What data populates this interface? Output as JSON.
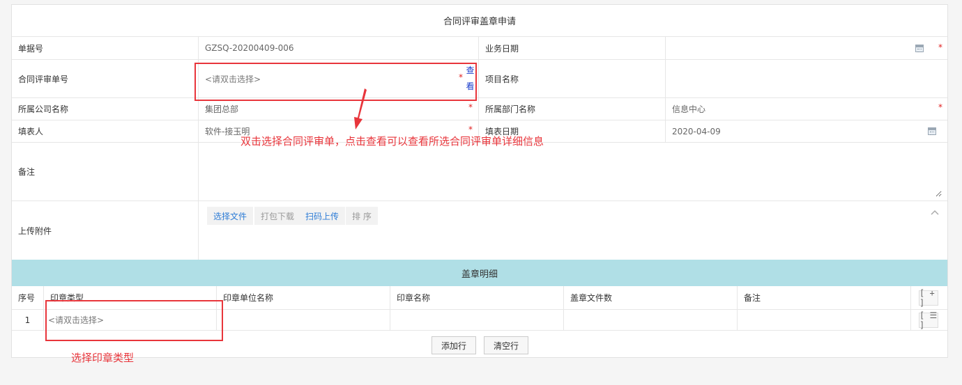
{
  "form": {
    "title": "合同评审盖章申请",
    "required_mark": "*",
    "fields": {
      "doc_no_label": "单据号",
      "doc_no_value": "GZSQ-20200409-006",
      "biz_date_label": "业务日期",
      "biz_date_value": "",
      "review_no_label": "合同评审单号",
      "review_no_placeholder": "<请双击选择>",
      "view_link_1": "查",
      "view_link_2": "看",
      "project_label": "项目名称",
      "project_value": "",
      "company_label": "所属公司名称",
      "company_value": "集团总部",
      "dept_label": "所属部门名称",
      "dept_value": "信息中心",
      "filler_label": "填表人",
      "filler_value": "软件-接玉明",
      "fill_date_label": "填表日期",
      "fill_date_value": "2020-04-09",
      "remark_label": "备注",
      "remark_value": "",
      "attach_label": "上传附件"
    },
    "upload_buttons": [
      "选择文件",
      "打包下载",
      "扫码上传",
      "排 序"
    ]
  },
  "detail": {
    "title": "盖章明细",
    "columns": [
      "序号",
      "印章类型",
      "印章单位名称",
      "印章名称",
      "盖章文件数",
      "备注"
    ],
    "add_col_button": "[ + ]",
    "rows": [
      {
        "no": "1",
        "seal_type_placeholder": "<请双击选择>",
        "seal_unit": "",
        "seal_name": "",
        "file_count": "",
        "remark": "",
        "row_menu": "[ ☰ ]"
      }
    ],
    "add_row_button": "添加行",
    "clear_rows_button": "清空行"
  },
  "annotations": {
    "review_hint": "双击选择合同评审单，点击查看可以查看所选合同评审单详细信息",
    "seal_hint": "选择印章类型"
  },
  "colors": {
    "annotation_red": "#e8353b",
    "detail_header_bg": "#b0dfe6",
    "link_blue": "#2d7cd6"
  }
}
